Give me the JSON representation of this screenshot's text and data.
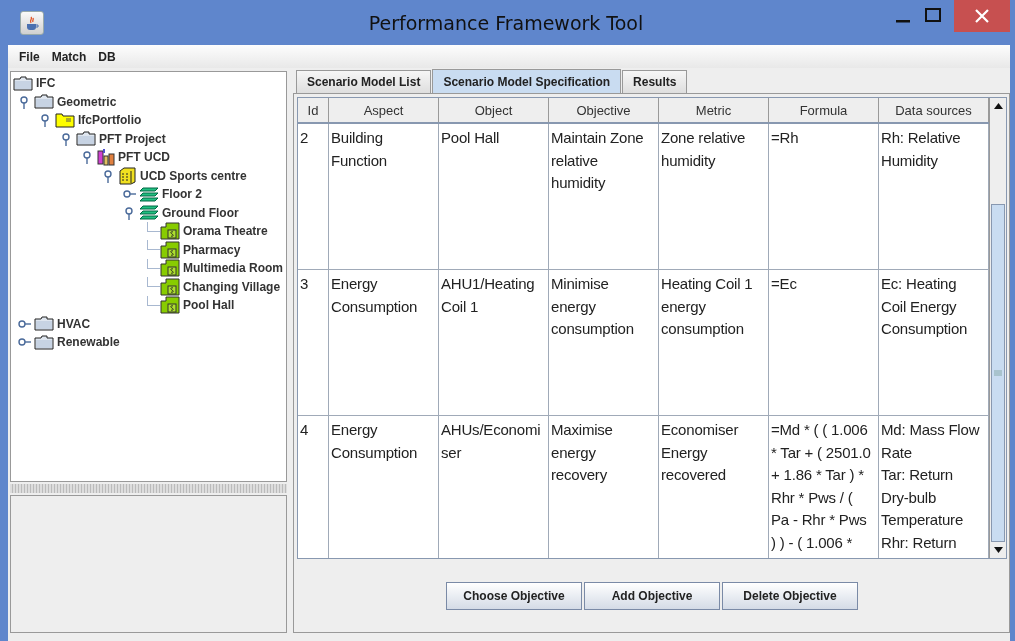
{
  "window": {
    "title": "Performance Framework Tool"
  },
  "menu": [
    "File",
    "Match",
    "DB"
  ],
  "tree": [
    {
      "label": "IFC",
      "kind": "folder",
      "children": [
        {
          "label": "Geometric",
          "kind": "folder",
          "expanded": true,
          "children": [
            {
              "label": "IfcPortfolio",
              "kind": "portfolio",
              "expanded": true,
              "children": [
                {
                  "label": "PFT Project",
                  "kind": "folder",
                  "expanded": true,
                  "children": [
                    {
                      "label": "PFT UCD",
                      "kind": "site",
                      "expanded": true,
                      "children": [
                        {
                          "label": "UCD Sports centre",
                          "kind": "building",
                          "expanded": true,
                          "children": [
                            {
                              "label": "Floor 2",
                              "kind": "storey",
                              "expanded": false
                            },
                            {
                              "label": "Ground Floor",
                              "kind": "storey",
                              "expanded": true,
                              "children": [
                                {
                                  "label": "Orama Theatre",
                                  "kind": "space"
                                },
                                {
                                  "label": "Pharmacy",
                                  "kind": "space"
                                },
                                {
                                  "label": "Multimedia Room",
                                  "kind": "space"
                                },
                                {
                                  "label": "Changing Village",
                                  "kind": "space"
                                },
                                {
                                  "label": "Pool Hall",
                                  "kind": "space"
                                }
                              ]
                            }
                          ]
                        }
                      ]
                    }
                  ]
                }
              ]
            }
          ]
        },
        {
          "label": "HVAC",
          "kind": "folder",
          "expanded": false
        },
        {
          "label": "Renewable",
          "kind": "folder",
          "expanded": false
        }
      ]
    }
  ],
  "tabs": [
    {
      "label": "Scenario Model List",
      "selected": false
    },
    {
      "label": "Scenario Model Specification",
      "selected": true
    },
    {
      "label": "Results",
      "selected": false
    }
  ],
  "table": {
    "columns": [
      "Id",
      "Aspect",
      "Object",
      "Objective",
      "Metric",
      "Formula",
      "Data sources"
    ],
    "rows": [
      [
        "2",
        "Building\nFunction",
        "Pool Hall",
        "Maintain Zone\nrelative\nhumidity",
        "Zone relative\nhumidity",
        "=Rh",
        "Rh: Relative\nHumidity"
      ],
      [
        "3",
        "Energy\nConsumption",
        "AHU1/Heating\nCoil 1",
        "Minimise\nenergy\nconsumption",
        "Heating Coil 1\nenergy\nconsumption",
        "=Ec",
        "Ec: Heating\nCoil Energy\nConsumption"
      ],
      [
        "4",
        "Energy\nConsumption",
        "AHUs/Economi\nser",
        "Maximise\nenergy\nrecovery",
        "Economiser\nEnergy\nrecovered",
        "=Md * ( ( 1.006\n* Tar + ( 2501.0\n+ 1.86 * Tar ) *\nRhr * Pws / (\nPa - Rhr * Pws\n) ) - ( 1.006 *",
        "Md: Mass Flow\nRate\nTar: Return\nDry-bulb\nTemperature\nRhr: Return"
      ]
    ]
  },
  "buttons": [
    "Choose Objective",
    "Add Objective",
    "Delete Objective"
  ]
}
